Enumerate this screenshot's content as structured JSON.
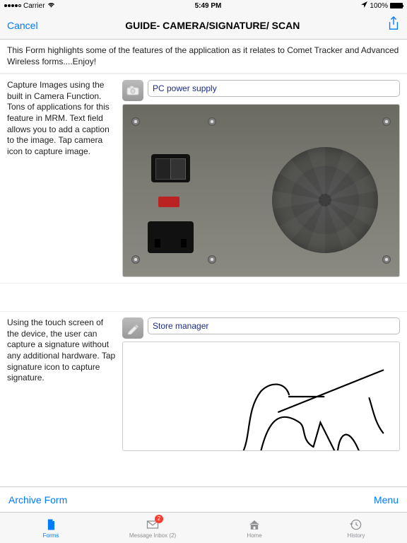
{
  "status": {
    "carrier": "Carrier",
    "time": "5:49 PM",
    "battery_pct": "100%"
  },
  "nav": {
    "cancel": "Cancel",
    "title": "GUIDE- CAMERA/SIGNATURE/ SCAN"
  },
  "intro": "This Form highlights some of the features of the application as it relates to Comet Tracker and Advanced Wireless forms....Enjoy!",
  "sections": {
    "camera": {
      "desc": "Capture Images using the built in Camera Function. Tons of applications for this feature in MRM. Text field allows you to add a caption to the image. Tap camera icon to capture image.",
      "caption": "PC power supply"
    },
    "signature": {
      "desc": "Using the touch screen of the device, the user can capture a signature without any additional hardware. Tap signature icon to capture signature.",
      "caption": "Store manager"
    }
  },
  "toolbar": {
    "archive": "Archive Form",
    "menu": "Menu"
  },
  "tabs": {
    "forms": "Forms",
    "inbox": "Message Inbox (2)",
    "inbox_badge": "2",
    "home": "Home",
    "history": "History"
  }
}
